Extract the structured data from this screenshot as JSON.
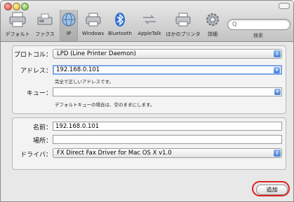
{
  "toolbar": {
    "items": [
      {
        "label": "デフォルト"
      },
      {
        "label": "ファクス"
      },
      {
        "label": "IP"
      },
      {
        "label": "Windows"
      },
      {
        "label": "Bluetooth"
      },
      {
        "label": "AppleTalk"
      },
      {
        "label": "ほかのプリンタ"
      },
      {
        "label": "詳細"
      }
    ],
    "search_label": "検索",
    "search_placeholder": ""
  },
  "form": {
    "protocol": {
      "label": "プロトコル：",
      "value": "LPD (Line Printer Daemon)"
    },
    "address": {
      "label": "アドレス：",
      "value": "192.168.0.101",
      "hint": "完全で正しいアドレスです。"
    },
    "queue": {
      "label": "キュー：",
      "value": "",
      "hint": "デフォルトキューの場合は、空のままにします。"
    },
    "name": {
      "label": "名前：",
      "value": "192.168.0.101"
    },
    "location": {
      "label": "場所：",
      "value": ""
    },
    "driver": {
      "label": "ドライバ：",
      "value": "FX Direct Fax Driver for Mac OS X v1.0"
    }
  },
  "add_button": "追加",
  "colors": {
    "accent": "#3f7fd9",
    "highlight": "#e02020"
  }
}
